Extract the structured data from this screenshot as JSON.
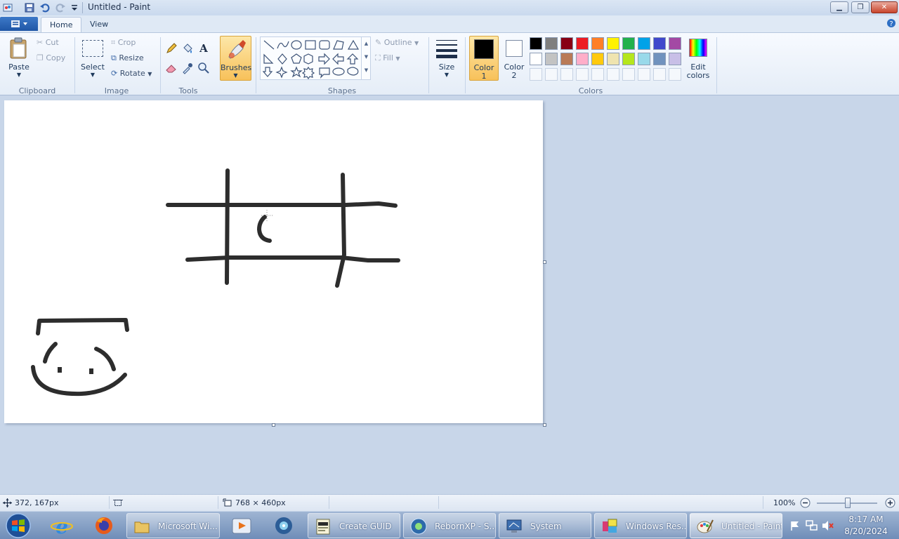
{
  "window": {
    "title": "Untitled - Paint"
  },
  "ribbon": {
    "tabs": [
      {
        "label": "Home"
      },
      {
        "label": "View"
      }
    ],
    "clipboard": {
      "paste": "Paste",
      "cut": "Cut",
      "copy": "Copy",
      "group": "Clipboard"
    },
    "image": {
      "select": "Select",
      "crop": "Crop",
      "resize": "Resize",
      "rotate": "Rotate",
      "group": "Image"
    },
    "tools": {
      "group": "Tools",
      "text_glyph": "A"
    },
    "brushes": {
      "label": "Brushes"
    },
    "shapes": {
      "outline": "Outline",
      "fill": "Fill",
      "group": "Shapes"
    },
    "size": {
      "label": "Size"
    },
    "colors": {
      "color1_line1": "Color",
      "color1_line2": "1",
      "color2_line1": "Color",
      "color2_line2": "2",
      "edit_line1": "Edit",
      "edit_line2": "colors",
      "group": "Colors",
      "color1": "#000000",
      "color2": "#ffffff",
      "palette_row1": [
        "#000000",
        "#7f7f7f",
        "#880015",
        "#ed1c24",
        "#ff7f27",
        "#fff200",
        "#22b14c",
        "#00a2e8",
        "#3f48cc",
        "#a349a4"
      ],
      "palette_row2": [
        "#ffffff",
        "#c3c3c3",
        "#b97a57",
        "#ffaec9",
        "#ffc90e",
        "#efe4b0",
        "#b5e61d",
        "#99d9ea",
        "#7092be",
        "#c8bfe7"
      ]
    }
  },
  "status": {
    "cursor": "372, 167px",
    "canvas_size": "768 × 460px",
    "zoom": "100%"
  },
  "taskbar": {
    "items": [
      {
        "label": "Microsoft Wi..."
      },
      {
        "label": "Create GUID"
      },
      {
        "label": "RebornXP - S..."
      },
      {
        "label": "System"
      },
      {
        "label": "Windows Res..."
      },
      {
        "label": "Untitled - Paint"
      }
    ],
    "clock": {
      "time": "8:17 AM",
      "date": "8/20/2024"
    }
  }
}
